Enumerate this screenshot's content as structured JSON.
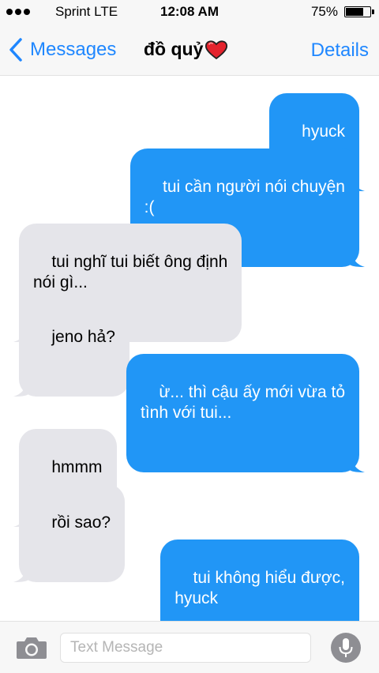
{
  "status_bar": {
    "carrier": "Sprint  LTE",
    "time": "12:08 AM",
    "battery_percent": "75%",
    "battery_level": 0.75
  },
  "nav": {
    "back_label": "Messages",
    "contact_name": "đồ quỷ",
    "heart_icon": "heart-icon",
    "details_label": "Details",
    "accent_color": "#1f87ff"
  },
  "messages": [
    {
      "direction": "sent",
      "text": "hyuck"
    },
    {
      "direction": "sent",
      "text": "tui cần người nói chuyện\n:("
    },
    {
      "direction": "received",
      "text": "tui nghĩ tui biết ông định\nnói gì..."
    },
    {
      "direction": "received",
      "text": "jeno hả?"
    },
    {
      "direction": "sent",
      "text": "ừ... thì cậu ấy mới vừa tỏ\ntình với tui..."
    },
    {
      "direction": "received",
      "text": "hmmm"
    },
    {
      "direction": "received",
      "text": "rồi sao?"
    },
    {
      "direction": "sent",
      "text": "tui không hiểu được,\nhyuck"
    }
  ],
  "input_bar": {
    "placeholder": "Text Message",
    "value": "",
    "camera_icon": "camera-icon",
    "mic_icon": "microphone-icon"
  },
  "colors": {
    "sent_bubble": "#2196f6",
    "received_bubble": "#e5e5ea"
  }
}
